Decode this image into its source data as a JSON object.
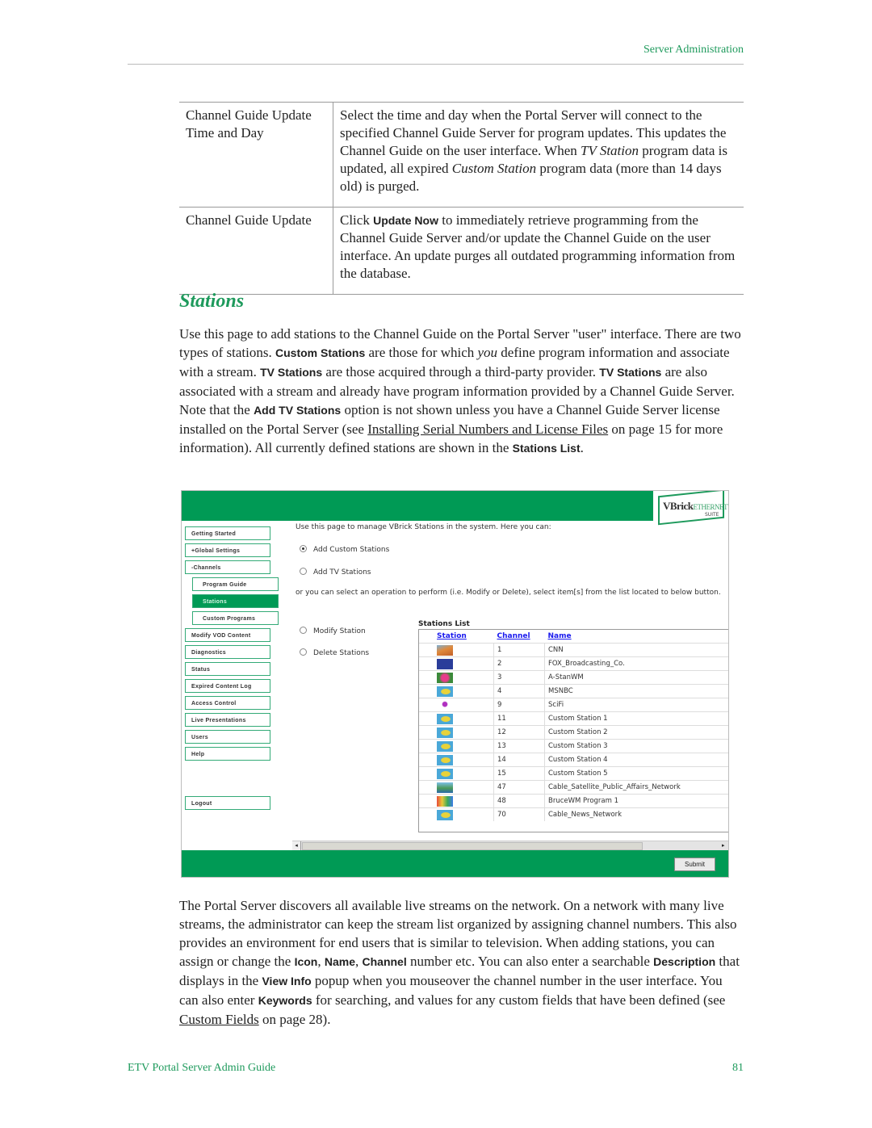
{
  "header": {
    "section": "Server Administration"
  },
  "params_table": [
    {
      "key": "Channel Guide Update Time and Day",
      "desc_parts": [
        {
          "t": "Select the time and day when the Portal Server will connect to the specified Channel Guide Server for program updates. This updates the Channel Guide on the user interface. When "
        },
        {
          "t": "TV Station",
          "style": "italic"
        },
        {
          "t": " program data is updated, all expired "
        },
        {
          "t": "Custom Station",
          "style": "italic"
        },
        {
          "t": " program data (more than 14 days old) is purged."
        }
      ]
    },
    {
      "key": "Channel Guide Update",
      "desc_parts": [
        {
          "t": "Click "
        },
        {
          "t": "Update Now",
          "style": "ui"
        },
        {
          "t": " to immediately retrieve programming from the Channel Guide Server and/or update the Channel Guide on the user interface. An update purges all outdated programming information from the database."
        }
      ]
    }
  ],
  "section_title": "Stations",
  "para1": [
    {
      "t": "Use this page to add stations to the Channel Guide on the Portal Server \"user\" interface. There are two types of stations. "
    },
    {
      "t": "Custom Stations",
      "style": "ui"
    },
    {
      "t": " are those for which "
    },
    {
      "t": "you",
      "style": "italic"
    },
    {
      "t": " define program information and associate with a stream. "
    },
    {
      "t": "TV Stations",
      "style": "ui"
    },
    {
      "t": " are those acquired through a third-party provider. "
    },
    {
      "t": "TV Stations",
      "style": "ui"
    },
    {
      "t": " are also associated with a stream and already have program information provided by a Channel Guide Server. Note that the "
    },
    {
      "t": "Add TV Stations",
      "style": "ui"
    },
    {
      "t": " option is not shown unless you have a Channel Guide Server license installed on the Portal Server (see "
    },
    {
      "t": "Installing Serial Numbers and License Files",
      "style": "link"
    },
    {
      "t": " on page 15 for more information). All currently defined stations are shown in the "
    },
    {
      "t": "Stations List",
      "style": "ui"
    },
    {
      "t": "."
    }
  ],
  "screenshot": {
    "logo": {
      "brand": "VBrick",
      "product": "ETHERNETV",
      "suite": "SUITE"
    },
    "colors": {
      "banner": "#009a55",
      "accent": "#1e9a5c",
      "link": "#1a1aee"
    },
    "nav": [
      {
        "label": "Getting Started",
        "level": 0,
        "active": false
      },
      {
        "label": "+Global Settings",
        "level": 0,
        "active": false
      },
      {
        "label": "-Channels",
        "level": 0,
        "active": false
      },
      {
        "label": "Program Guide",
        "level": 1,
        "active": false
      },
      {
        "label": "Stations",
        "level": 1,
        "active": true
      },
      {
        "label": "Custom Programs",
        "level": 1,
        "active": false
      },
      {
        "label": "Modify VOD Content",
        "level": 0,
        "active": false
      },
      {
        "label": "Diagnostics",
        "level": 0,
        "active": false
      },
      {
        "label": "Status",
        "level": 0,
        "active": false
      },
      {
        "label": "Expired Content Log",
        "level": 0,
        "active": false
      },
      {
        "label": "Access Control",
        "level": 0,
        "active": false
      },
      {
        "label": "Live Presentations",
        "level": 0,
        "active": false
      },
      {
        "label": "Users",
        "level": 0,
        "active": false
      },
      {
        "label": "Help",
        "level": 0,
        "active": false
      }
    ],
    "logout_label": "Logout",
    "intro": "Use this page to manage VBrick Stations in the system. Here you can:",
    "add_options": [
      {
        "label": "Add Custom Stations",
        "checked": true
      },
      {
        "label": "Add TV Stations",
        "checked": false
      }
    ],
    "or_text": "or you can select an operation to perform (i.e. Modify or Delete), select item[s] from the list located to below button.",
    "operations": [
      {
        "label": "Modify Station",
        "checked": false
      },
      {
        "label": "Delete Stations",
        "checked": false
      }
    ],
    "stations_list": {
      "title": "Stations List",
      "columns": [
        "Station",
        "Channel",
        "Name"
      ],
      "rows": [
        {
          "icon": "cnn-logo-icon",
          "channel": "1",
          "name": "CNN"
        },
        {
          "icon": "fox-news-logo-icon",
          "channel": "2",
          "name": "FOX_Broadcasting_Co."
        },
        {
          "icon": "flower-icon",
          "channel": "3",
          "name": "A-StanWM"
        },
        {
          "icon": "default-station-icon",
          "channel": "4",
          "name": "MSNBC"
        },
        {
          "icon": "scifi-logo-icon",
          "channel": "9",
          "name": "SciFi"
        },
        {
          "icon": "default-station-icon",
          "channel": "11",
          "name": "Custom Station 1"
        },
        {
          "icon": "default-station-icon",
          "channel": "12",
          "name": "Custom Station 2"
        },
        {
          "icon": "default-station-icon",
          "channel": "13",
          "name": "Custom Station 3"
        },
        {
          "icon": "default-station-icon",
          "channel": "14",
          "name": "Custom Station 4"
        },
        {
          "icon": "default-station-icon",
          "channel": "15",
          "name": "Custom Station 5"
        },
        {
          "icon": "island-icon",
          "channel": "47",
          "name": "Cable_Satellite_Public_Affairs_Network"
        },
        {
          "icon": "colorful-logo-icon",
          "channel": "48",
          "name": "BruceWM Program 1"
        },
        {
          "icon": "default-station-icon",
          "channel": "70",
          "name": "Cable_News_Network"
        }
      ]
    },
    "submit_label": "Submit"
  },
  "para2": [
    {
      "t": "The Portal Server discovers all available live streams on the network. On a network with many live streams, the administrator can keep the stream list organized by assigning channel numbers. This also provides an environment for end users that is similar to television. When adding stations, you can assign or change the "
    },
    {
      "t": "Icon",
      "style": "ui"
    },
    {
      "t": ", "
    },
    {
      "t": "Name",
      "style": "ui"
    },
    {
      "t": ", "
    },
    {
      "t": "Channel",
      "style": "ui"
    },
    {
      "t": " number etc. You can also enter a searchable "
    },
    {
      "t": "Description",
      "style": "ui"
    },
    {
      "t": " that displays in the "
    },
    {
      "t": "View Info",
      "style": "ui"
    },
    {
      "t": " popup when you mouseover the channel number in the user interface. You can also enter "
    },
    {
      "t": "Keywords",
      "style": "ui"
    },
    {
      "t": " for searching, and values for any custom fields that have been defined (see "
    },
    {
      "t": "Custom Fields",
      "style": "link"
    },
    {
      "t": " on page 28)."
    }
  ],
  "footer": {
    "title": "ETV Portal Server Admin Guide",
    "page": "81"
  }
}
